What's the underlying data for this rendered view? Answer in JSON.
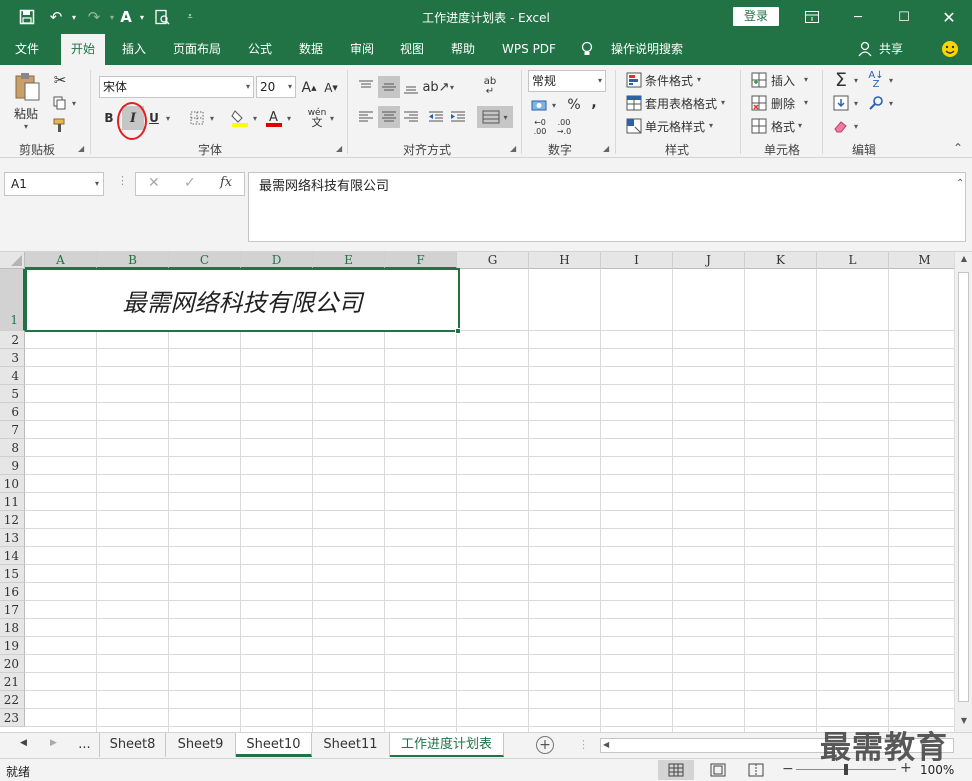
{
  "window": {
    "title": "工作进度计划表 - Excel",
    "login_label": "登录"
  },
  "menu": {
    "tabs": [
      "文件",
      "开始",
      "插入",
      "页面布局",
      "公式",
      "数据",
      "审阅",
      "视图",
      "帮助",
      "WPS PDF",
      "操作说明搜索"
    ],
    "active_tab": "开始",
    "share_label": "共享"
  },
  "ribbon": {
    "clipboard": {
      "paste_label": "粘贴",
      "group_label": "剪贴板"
    },
    "font": {
      "font_name": "宋体",
      "font_size": "20",
      "bold_label": "B",
      "italic_label": "I",
      "underline_label": "U",
      "group_label": "字体",
      "fill_color": "#ffff00",
      "font_color": "#e00000"
    },
    "alignment": {
      "group_label": "对齐方式"
    },
    "number": {
      "format": "常规",
      "percent": "%",
      "comma": ",",
      "group_label": "数字"
    },
    "styles": {
      "conditional_label": "条件格式",
      "table_label": "套用表格格式",
      "cell_styles_label": "单元格样式",
      "group_label": "样式"
    },
    "cells": {
      "insert_label": "插入",
      "delete_label": "删除",
      "format_label": "格式",
      "group_label": "单元格"
    },
    "editing": {
      "group_label": "编辑"
    }
  },
  "formula_bar": {
    "name_box": "A1",
    "fx_label": "fx",
    "content": "最需网络科技有限公司"
  },
  "grid": {
    "columns": [
      "A",
      "B",
      "C",
      "D",
      "E",
      "F",
      "G",
      "H",
      "I",
      "J",
      "K",
      "L",
      "M"
    ],
    "rows": [
      "1",
      "2",
      "3",
      "4",
      "5",
      "6",
      "7",
      "8",
      "9",
      "10",
      "11",
      "12",
      "13",
      "14",
      "15",
      "16",
      "17",
      "18",
      "19",
      "20",
      "21",
      "22",
      "23"
    ],
    "merged_cell_text": "最需网络科技有限公司"
  },
  "sheets": {
    "ellipsis": "...",
    "tabs": [
      "Sheet8",
      "Sheet9",
      "Sheet10",
      "Sheet11",
      "工作进度计划表"
    ],
    "active": "Sheet10",
    "current": "工作进度计划表"
  },
  "status": {
    "ready": "就绪",
    "zoom": "100%"
  },
  "watermark": "最需教育",
  "colors": {
    "accent": "#217346",
    "highlight_circle": "#e02020"
  }
}
